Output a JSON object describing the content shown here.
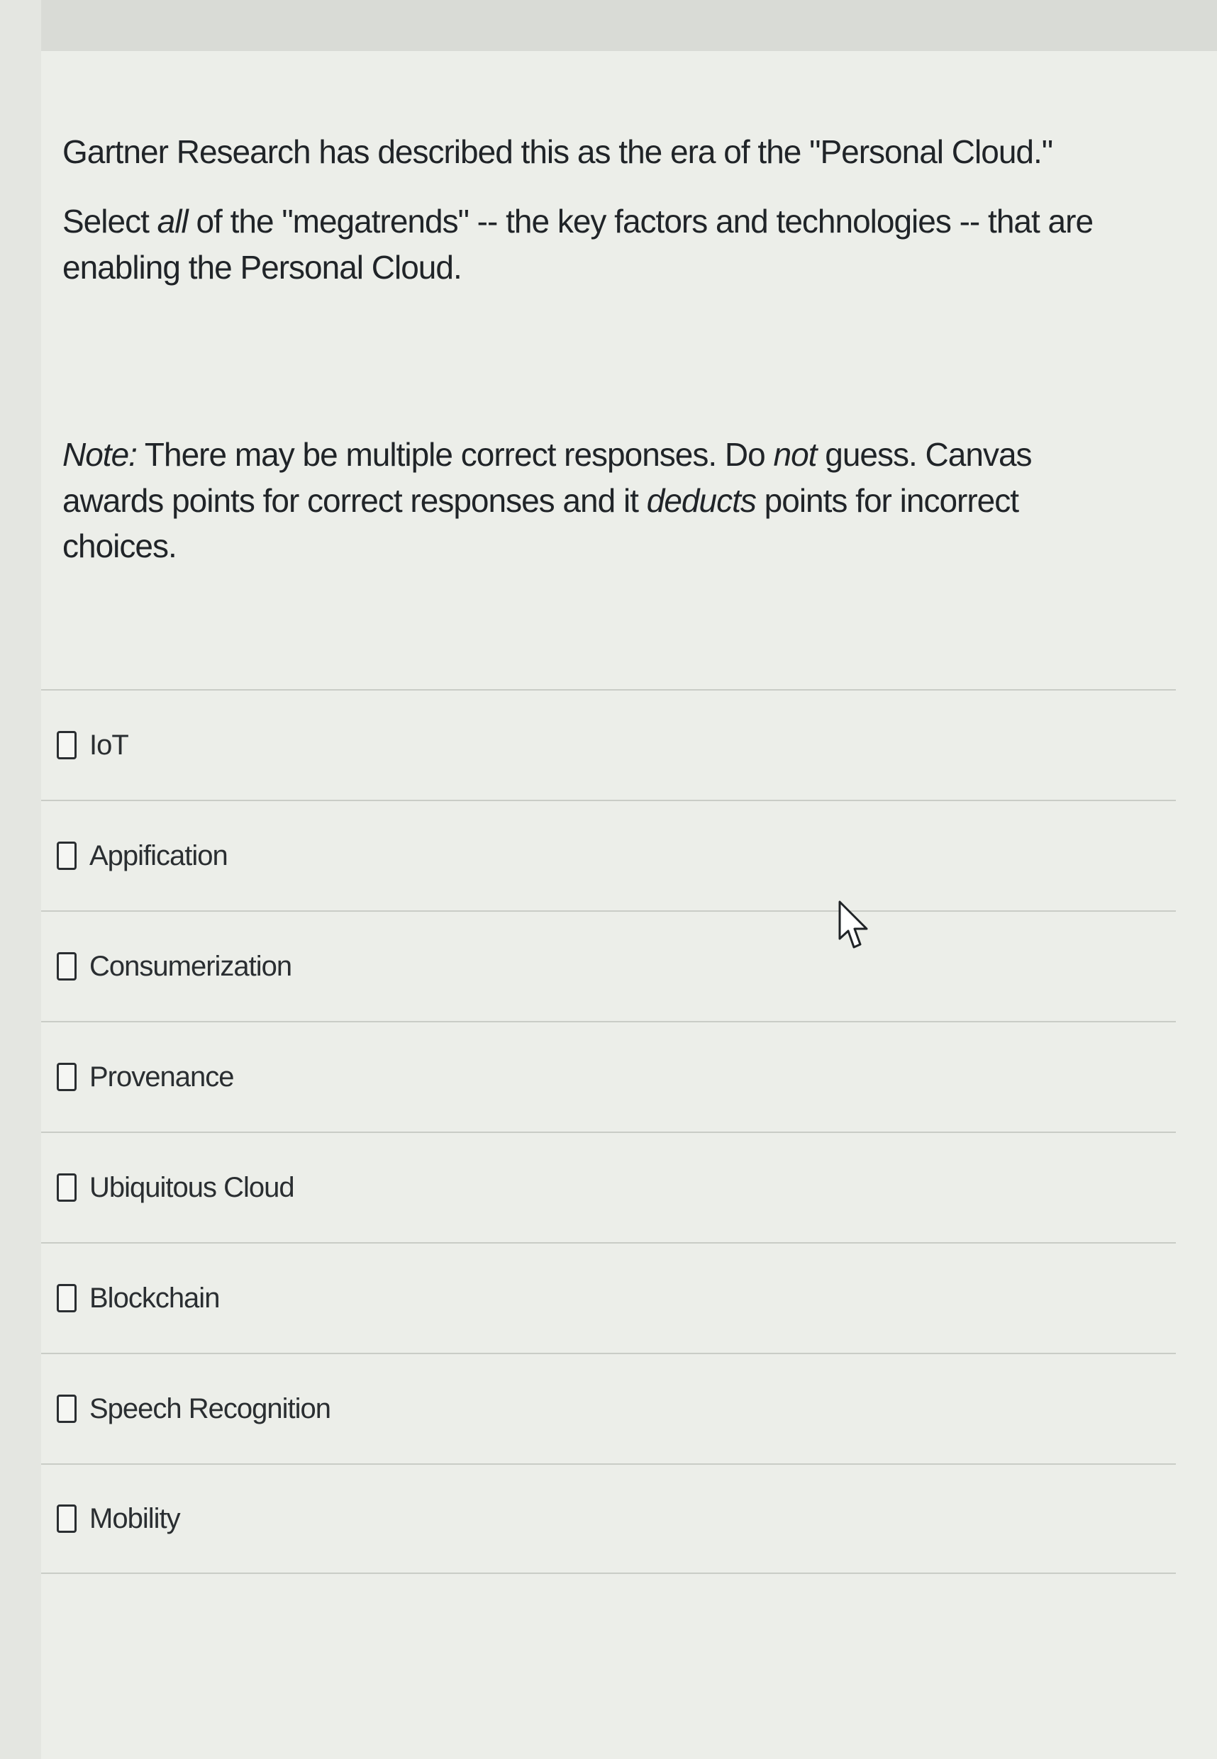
{
  "question": {
    "intro": "Gartner Research has described this as the era of the \"Personal Cloud.\"",
    "prompt_start": "Select ",
    "prompt_emphasis": "all",
    "prompt_end": " of the \"megatrends\" -- the key factors and technologies -- that are enabling the Personal Cloud.",
    "note_label": "Note:",
    "note_part1": " There may be multiple correct responses. Do ",
    "note_emphasis1": "not",
    "note_part2": " guess.  Canvas awards points for correct responses and it ",
    "note_emphasis2": "deducts",
    "note_part3": " points for incorrect choices."
  },
  "answers": [
    {
      "label": "IoT",
      "checked": false
    },
    {
      "label": "Appification",
      "checked": false
    },
    {
      "label": "Consumerization",
      "checked": false
    },
    {
      "label": "Provenance",
      "checked": false
    },
    {
      "label": "Ubiquitous Cloud",
      "checked": false
    },
    {
      "label": "Blockchain",
      "checked": false
    },
    {
      "label": "Speech Recognition",
      "checked": false
    },
    {
      "label": "Mobility",
      "checked": false
    }
  ],
  "cursor": {
    "icon": "mouse-pointer-icon"
  }
}
